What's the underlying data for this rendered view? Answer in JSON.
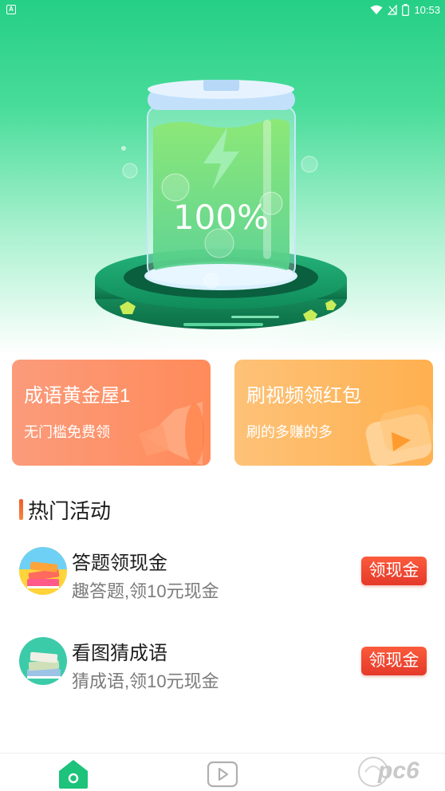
{
  "status_bar": {
    "left_icon_letter": "A",
    "time": "10:53",
    "battery_level": "1"
  },
  "hero": {
    "battery_percent": "100%"
  },
  "cards": [
    {
      "title": "成语黄金屋1",
      "subtitle": "无门槛免费领",
      "icon": "megaphone-icon"
    },
    {
      "title": "刷视频领红包",
      "subtitle": "刷的多赚的多",
      "icon": "video-play-icon"
    }
  ],
  "section": {
    "title": "热门活动"
  },
  "activities": [
    {
      "title": "答题领现金",
      "subtitle": "趣答题,领10元现金",
      "button": "领现金",
      "icon": "books-icon"
    },
    {
      "title": "看图猜成语",
      "subtitle": "猜成语,领10元现金",
      "button": "领现金",
      "icon": "book-stack-icon"
    }
  ],
  "tabbar": {
    "tabs": [
      {
        "name": "home",
        "icon": "home-icon",
        "active": true
      },
      {
        "name": "video",
        "icon": "video-icon",
        "active": false
      }
    ]
  },
  "watermark": {
    "text": "pc6"
  },
  "colors": {
    "primary_green": "#25cf86",
    "orange_card": "#ff8b5a",
    "yellow_card": "#ffb04f",
    "button_red": "#e5392a"
  }
}
